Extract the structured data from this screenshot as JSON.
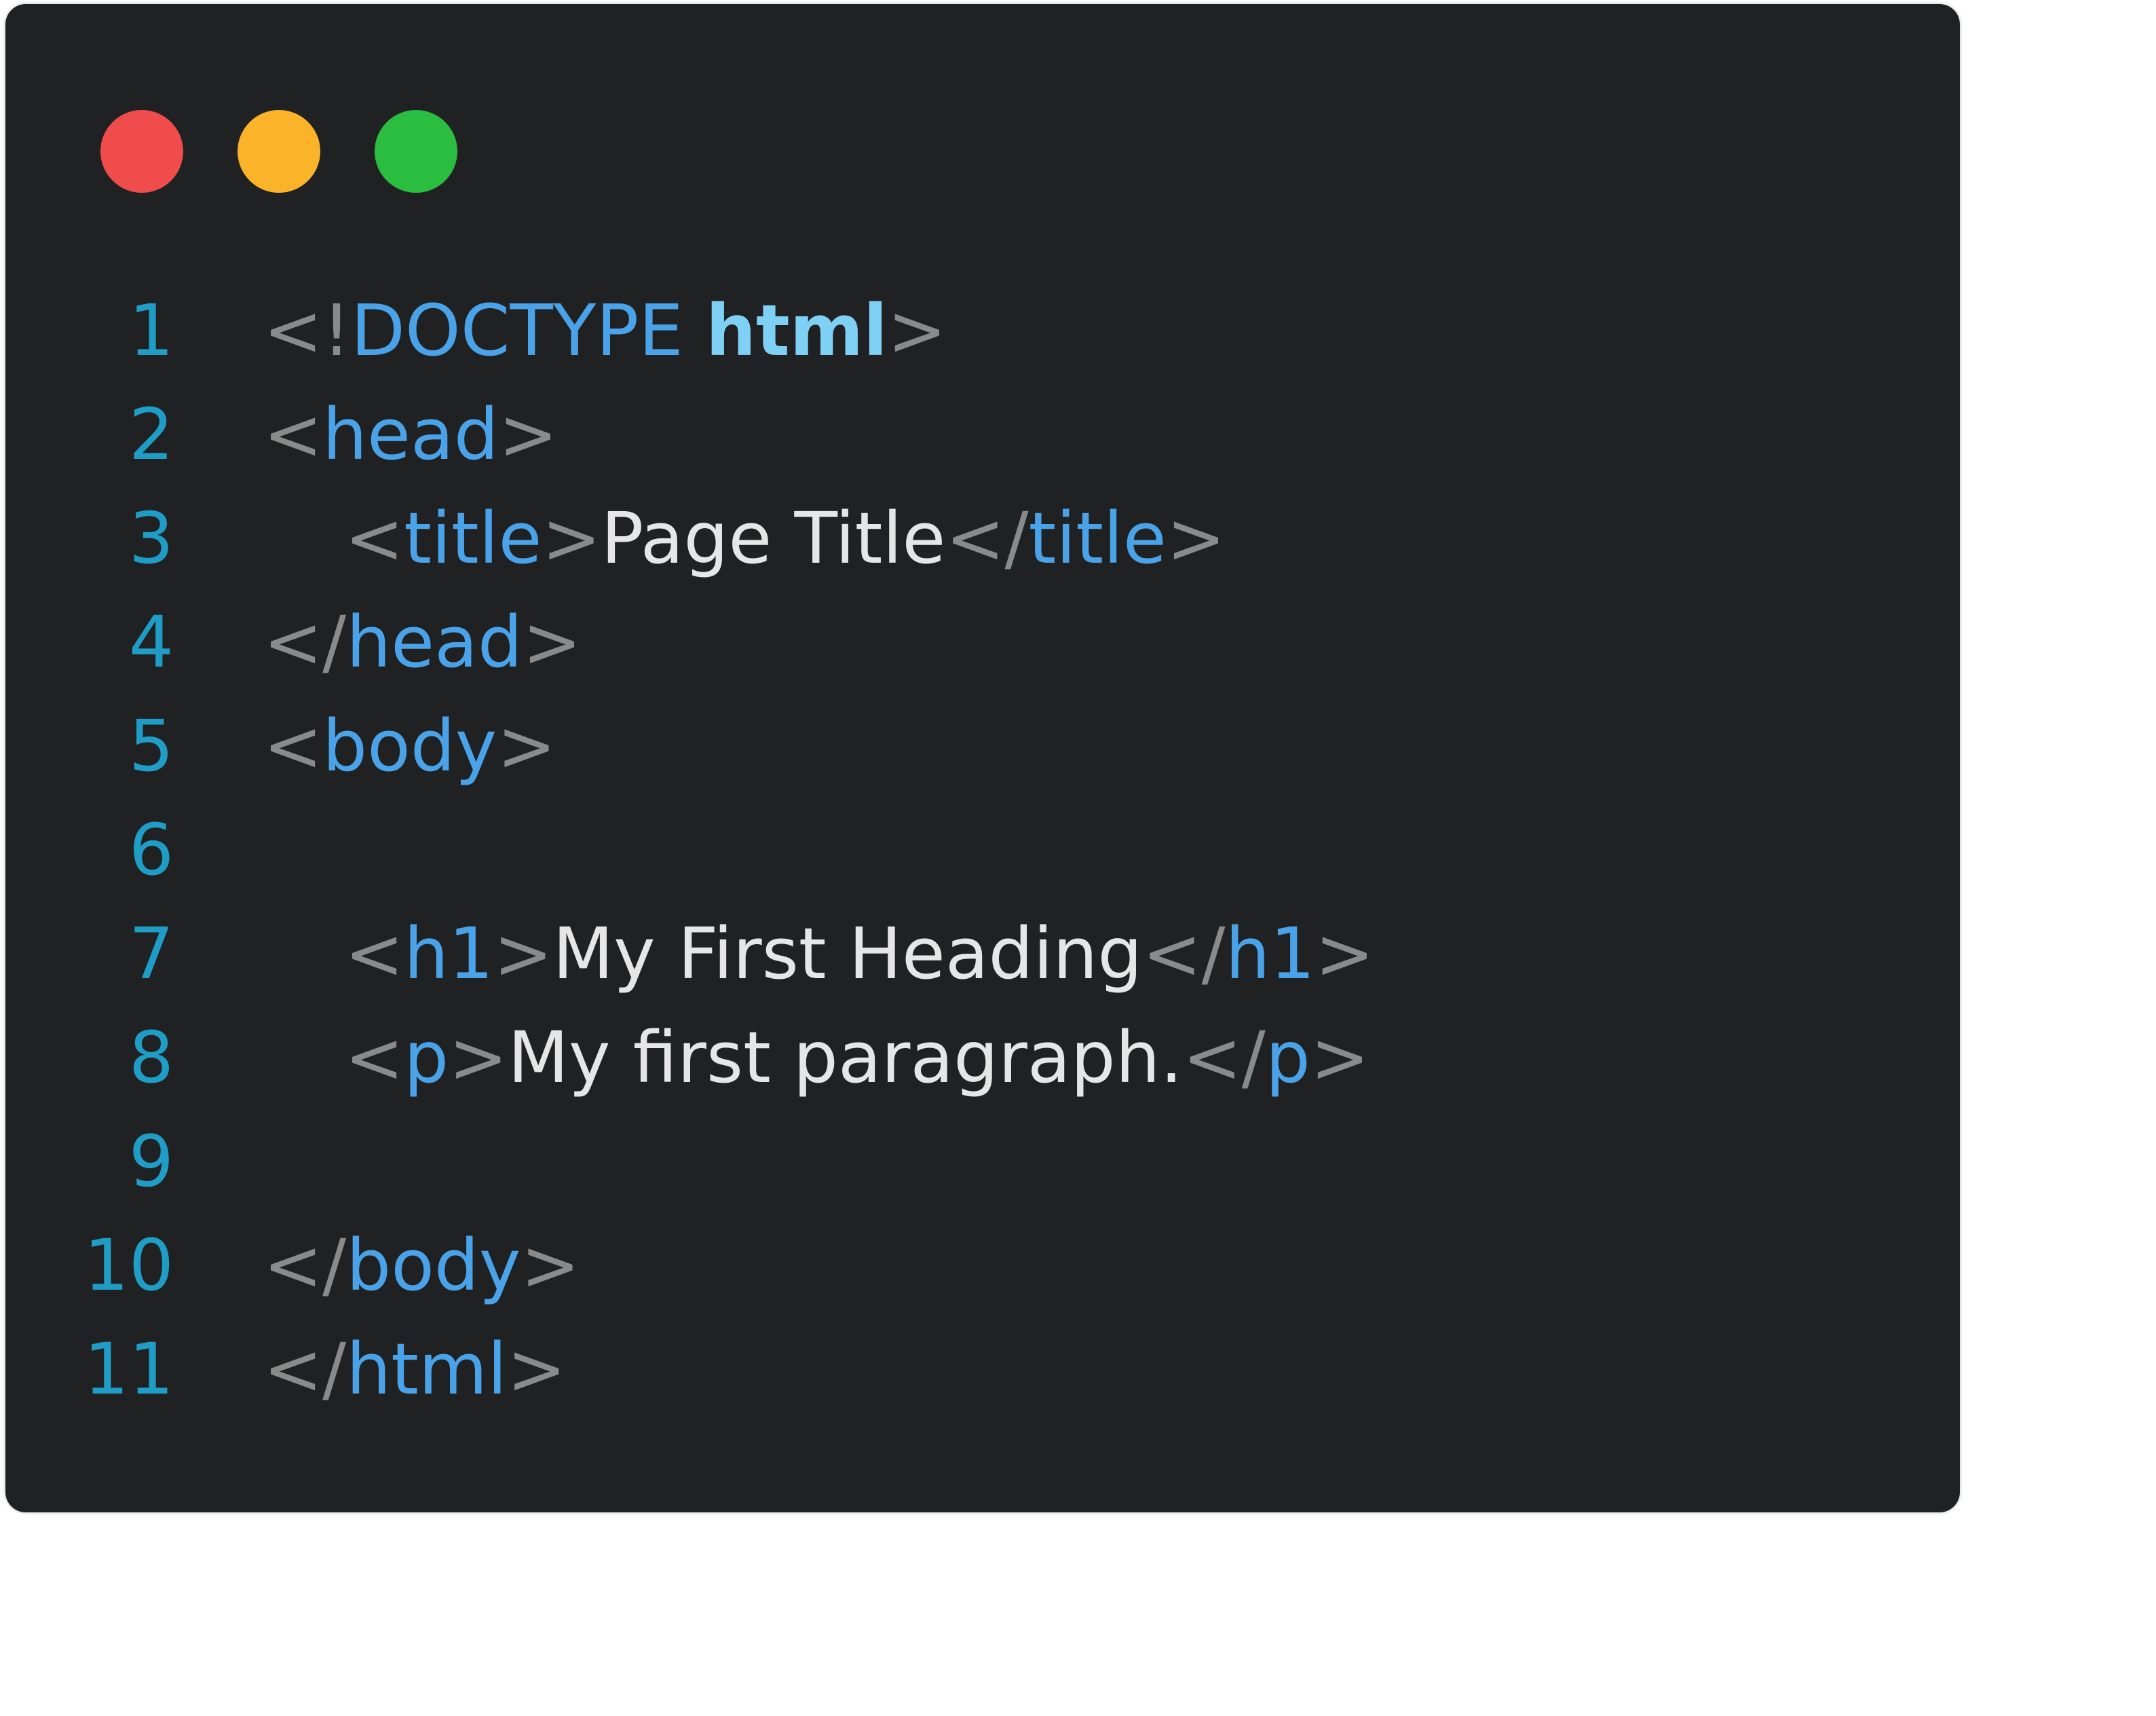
{
  "window": {
    "controls": [
      {
        "name": "close",
        "color": "#f04c4c"
      },
      {
        "name": "minimize",
        "color": "#fbb42a"
      },
      {
        "name": "maximize",
        "color": "#2bbd3f"
      }
    ]
  },
  "colors": {
    "background": "#202122",
    "line_number": "#1f9dc6",
    "punctuation": "#8a8a8a",
    "tag": "#4aa3e8",
    "attribute": "#7fd0f5",
    "text": "#e6e6e6"
  },
  "lines": [
    {
      "number": "1",
      "indent": false,
      "tokens": [
        {
          "t": "<!",
          "k": "punct"
        },
        {
          "t": "DOCTYPE ",
          "k": "keyword"
        },
        {
          "t": "html",
          "k": "attr"
        },
        {
          "t": ">",
          "k": "punct"
        }
      ]
    },
    {
      "number": "2",
      "indent": false,
      "tokens": [
        {
          "t": "<",
          "k": "punct"
        },
        {
          "t": "head",
          "k": "tag"
        },
        {
          "t": ">",
          "k": "punct"
        }
      ]
    },
    {
      "number": "3",
      "indent": true,
      "tokens": [
        {
          "t": "<",
          "k": "punct"
        },
        {
          "t": "title",
          "k": "tag"
        },
        {
          "t": ">",
          "k": "punct"
        },
        {
          "t": "Page Title",
          "k": "text"
        },
        {
          "t": "</",
          "k": "punct"
        },
        {
          "t": "title",
          "k": "tag"
        },
        {
          "t": ">",
          "k": "punct"
        }
      ]
    },
    {
      "number": "4",
      "indent": false,
      "tokens": [
        {
          "t": "</",
          "k": "punct"
        },
        {
          "t": "head",
          "k": "tag"
        },
        {
          "t": ">",
          "k": "punct"
        }
      ]
    },
    {
      "number": "5",
      "indent": false,
      "tokens": [
        {
          "t": "<",
          "k": "punct"
        },
        {
          "t": "body",
          "k": "tag"
        },
        {
          "t": ">",
          "k": "punct"
        }
      ]
    },
    {
      "number": "6",
      "indent": false,
      "tokens": []
    },
    {
      "number": "7",
      "indent": true,
      "tokens": [
        {
          "t": "<",
          "k": "punct"
        },
        {
          "t": "h1",
          "k": "tag"
        },
        {
          "t": ">",
          "k": "punct"
        },
        {
          "t": "My First Heading",
          "k": "text"
        },
        {
          "t": "</",
          "k": "punct"
        },
        {
          "t": "h1",
          "k": "tag"
        },
        {
          "t": ">",
          "k": "punct"
        }
      ]
    },
    {
      "number": "8",
      "indent": true,
      "tokens": [
        {
          "t": "<",
          "k": "punct"
        },
        {
          "t": "p",
          "k": "tag"
        },
        {
          "t": ">",
          "k": "punct"
        },
        {
          "t": "My first paragraph.",
          "k": "text"
        },
        {
          "t": "</",
          "k": "punct"
        },
        {
          "t": "p",
          "k": "tag"
        },
        {
          "t": ">",
          "k": "punct"
        }
      ]
    },
    {
      "number": "9",
      "indent": false,
      "tokens": []
    },
    {
      "number": "10",
      "indent": false,
      "tokens": [
        {
          "t": "</",
          "k": "punct"
        },
        {
          "t": "body",
          "k": "tag"
        },
        {
          "t": ">",
          "k": "punct"
        }
      ]
    },
    {
      "number": "11",
      "indent": false,
      "tokens": [
        {
          "t": "</",
          "k": "punct"
        },
        {
          "t": "html",
          "k": "tag"
        },
        {
          "t": ">",
          "k": "punct"
        }
      ]
    }
  ]
}
